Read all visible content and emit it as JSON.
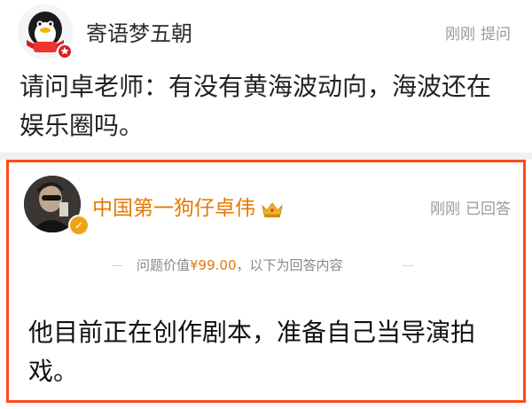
{
  "question": {
    "username": "寄语梦五朝",
    "time": "刚刚",
    "action": "提问",
    "text": "请问卓老师：有没有黄海波动向，海波还在娱乐圈吗。"
  },
  "answer": {
    "username": "中国第一狗仔卓伟",
    "time": "刚刚",
    "action": "已回答",
    "value_prefix": "问题价值",
    "price": "¥99.00",
    "value_suffix": "，以下为回答内容",
    "text": "他目前正在创作剧本，准备自己当导演拍戏。"
  },
  "colors": {
    "highlight_border": "#ff4a1c",
    "vip_name": "#e47a00"
  },
  "icons": [
    "penguin-avatar",
    "user-avatar",
    "verified-badge-icon",
    "crown-icon"
  ]
}
